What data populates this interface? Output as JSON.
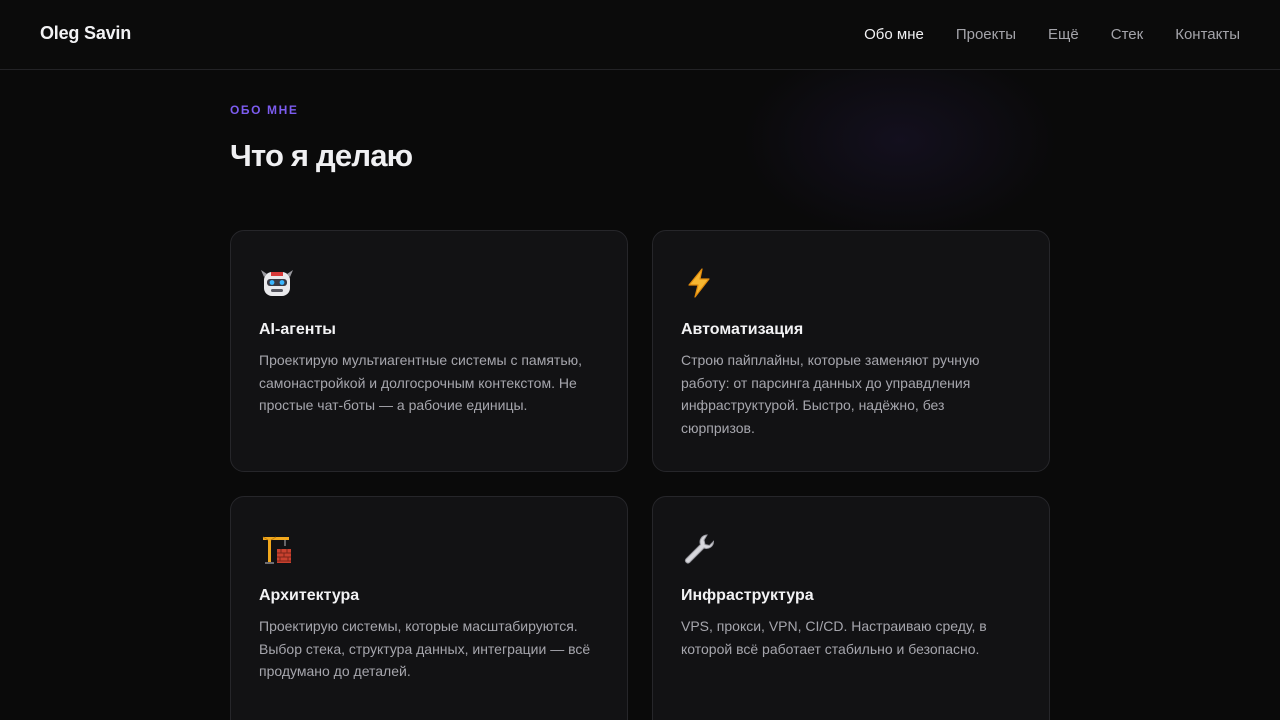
{
  "header": {
    "brand": "Oleg Savin",
    "nav": [
      "Обо мне",
      "Проекты",
      "Ещё",
      "Стек",
      "Контакты"
    ]
  },
  "section": {
    "eyebrow": "ОБО МНЕ",
    "title": "Что я делаю"
  },
  "cards": [
    {
      "icon": "robot-icon",
      "title": "AI-агенты",
      "text": "Проектирую мультиагентные системы с памятью, самонастройкой и долгосрочным контекстом. Не простые чат-боты — а рабочие единицы."
    },
    {
      "icon": "lightning-icon",
      "title": "Автоматизация",
      "text": "Строю пайплайны, которые заменяют ручную работу: от парсинга данных до управдления инфраструктурой. Быстро, надёжно, без сюрпризов."
    },
    {
      "icon": "construction-crane-icon",
      "title": "Архитектура",
      "text": "Проектирую системы, которые масштабируются. Выбор стека, структура данных, интеграции — всё продумано до деталей."
    },
    {
      "icon": "wrench-icon",
      "title": "Инфраструктура",
      "text": "VPS, прокси, VPN, CI/CD. Настраиваю среду, в которой всё работает стабильно и безопасно."
    }
  ],
  "colors": {
    "background": "#0a0a0a",
    "accent": "#7c5cf0",
    "card": "#121214"
  }
}
